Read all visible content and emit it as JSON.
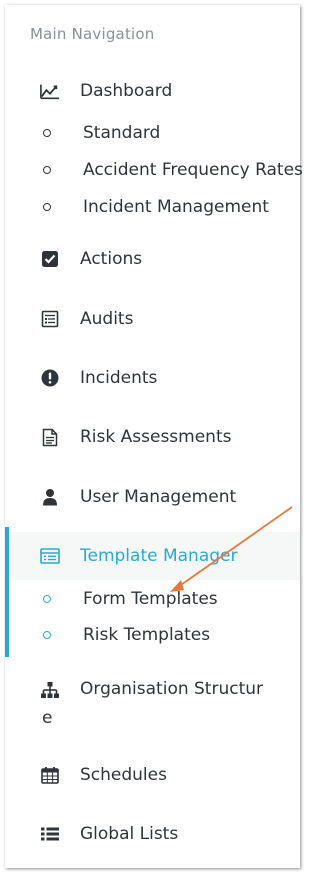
{
  "nav": {
    "section_title": "Main Navigation",
    "dashboard": {
      "label": "Dashboard",
      "icon": "line-chart-icon",
      "children": [
        "Standard",
        "Accident Frequency Rates",
        "Incident Management"
      ]
    },
    "items": [
      {
        "label": "Actions",
        "icon": "check-square-icon"
      },
      {
        "label": "Audits",
        "icon": "audit-list-icon"
      },
      {
        "label": "Incidents",
        "icon": "exclamation-circle-icon"
      },
      {
        "label": "Risk Assessments",
        "icon": "document-icon"
      },
      {
        "label": "User Management",
        "icon": "user-icon"
      }
    ],
    "template_manager": {
      "label": "Template Manager",
      "icon": "template-list-icon",
      "children": [
        "Form Templates",
        "Risk Templates"
      ]
    },
    "organisation": {
      "label_line1": "Organisation Structur",
      "label_line2": "e",
      "icon": "sitemap-icon"
    },
    "schedules": {
      "label": "Schedules",
      "icon": "calendar-icon"
    },
    "global_lists": {
      "label": "Global Lists",
      "icon": "list-icon"
    }
  },
  "colors": {
    "accent": "#2ba7d6",
    "arrow": "#e8783a",
    "text": "#2f343a",
    "muted": "#8b9096"
  }
}
